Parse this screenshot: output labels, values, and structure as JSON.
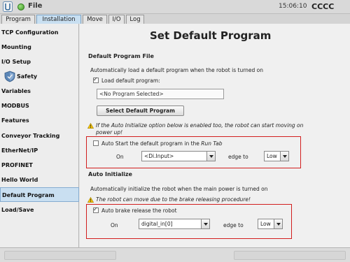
{
  "app": {
    "menu_file": "File",
    "clock": "15:06:10",
    "robot_name": "CCCC"
  },
  "tabs": [
    "Program",
    "Installation",
    "Move",
    "I/O",
    "Log"
  ],
  "sidebar": {
    "items": [
      {
        "label": "TCP Configuration"
      },
      {
        "label": "Mounting"
      },
      {
        "label": "I/O Setup"
      },
      {
        "label": "Safety"
      },
      {
        "label": "Variables"
      },
      {
        "label": "MODBUS"
      },
      {
        "label": "Features"
      },
      {
        "label": "Conveyor Tracking"
      },
      {
        "label": "EtherNet/IP"
      },
      {
        "label": "PROFINET"
      },
      {
        "label": "Hello World"
      },
      {
        "label": "Default Program"
      },
      {
        "label": "Load/Save"
      }
    ]
  },
  "main": {
    "title": "Set Default Program",
    "default_program_file": {
      "heading": "Default Program File",
      "description": "Automatically load a default program when the robot is turned on",
      "load_checkbox_label": "Load default program:",
      "load_checked": true,
      "program_field_value": "<No Program Selected>",
      "select_button_label": "Select Default Program",
      "warning_line1": "If the Auto Initialize option below is enabled too, the robot can start moving on",
      "warning_line2": "power up!",
      "autostart_label_prefix": "Auto Start the default program in the ",
      "autostart_label_tab": "Run Tab",
      "autostart_checked": false,
      "on_label": "On",
      "input_select_value": "<Di.Input>",
      "edge_label": "edge to",
      "edge_select_value": "Low"
    },
    "auto_initialize": {
      "heading": "Auto Initialize",
      "description": "Automatically initialize the robot when the main power is turned on",
      "warning": "The robot can move due to the brake releasing procedure!",
      "brake_checkbox_label": "Auto brake release the robot",
      "brake_checked": true,
      "on_label": "On",
      "input_select_value": "digital_in[0]",
      "edge_label": "edge to",
      "edge_select_value": "Low"
    }
  },
  "colors": {
    "highlight_box": "#d21e1e",
    "active_tab": "#c8dff1",
    "active_sidebar": "#c9dff1"
  }
}
